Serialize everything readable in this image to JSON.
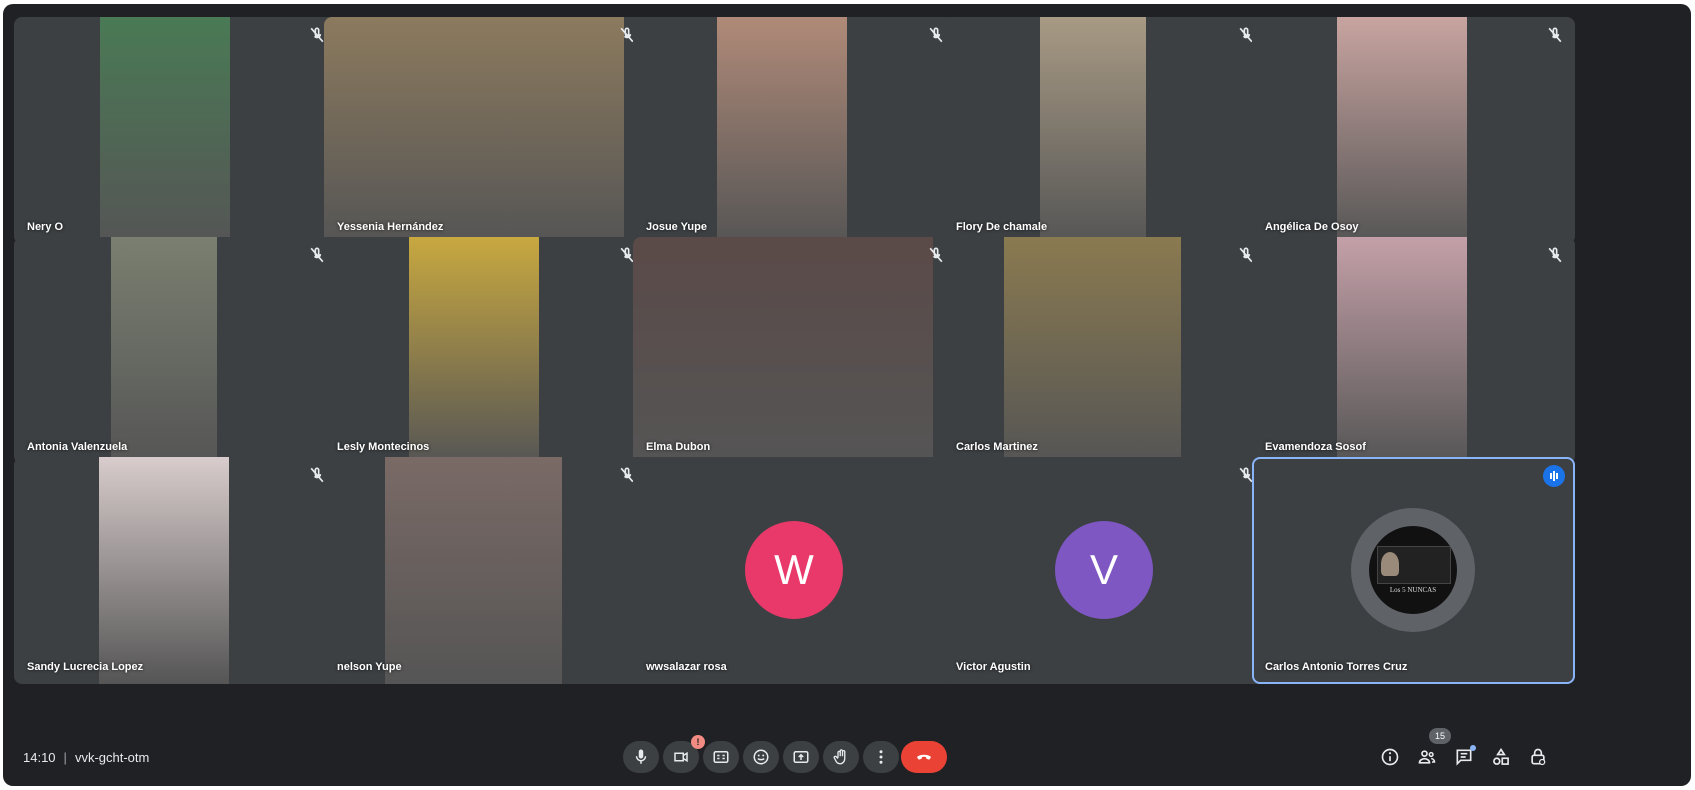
{
  "meeting": {
    "time": "14:10",
    "code": "vvk-gcht-otm",
    "participant_count": "15",
    "camera_warning": "!"
  },
  "participants": [
    {
      "name": "Nery O",
      "muted": true,
      "video_color": "#4a7a55"
    },
    {
      "name": "Yessenia Hernández",
      "muted": true,
      "video_color": "#8c7a5e"
    },
    {
      "name": "Josue Yupe",
      "muted": true,
      "video_color": "#b08a78"
    },
    {
      "name": "Flory De chamale",
      "muted": true,
      "video_color": "#a89a84"
    },
    {
      "name": "Angélica De Osoy",
      "muted": true,
      "video_color": "#c8a4a0"
    },
    {
      "name": "Antonia Valenzuela",
      "muted": true,
      "video_color": "#7a7f70"
    },
    {
      "name": "Lesly Montecinos",
      "muted": true,
      "video_color": "#c8a840"
    },
    {
      "name": "Elma Dubon",
      "muted": true,
      "video_color": "#5a4a48"
    },
    {
      "name": "Carlos Martinez",
      "muted": true,
      "video_color": "#8a7a50"
    },
    {
      "name": "Evamendoza Sosof",
      "muted": true,
      "video_color": "#c4a0a8"
    },
    {
      "name": "Sandy Lucrecia Lopez",
      "muted": true,
      "video_color": "#d8cccc"
    },
    {
      "name": "nelson Yupe",
      "muted": true,
      "video_color": "#7a6a66"
    },
    {
      "name": "wwsalazar rosa",
      "muted": false,
      "avatar_letter": "W",
      "avatar_color": "#e8396a"
    },
    {
      "name": "Victor Agustin",
      "muted": true,
      "avatar_letter": "V",
      "avatar_color": "#7e57c2"
    },
    {
      "name": "Carlos Antonio Torres Cruz",
      "muted": false,
      "speaking": true,
      "avatar_image_caption": "Los 5 NUNCAS"
    }
  ],
  "controls": {
    "accent": "#1a73e8",
    "end_call_color": "#ea4335",
    "icons": [
      "microphone-icon",
      "camera-icon",
      "captions-icon",
      "emoji-icon",
      "present-icon",
      "raise-hand-icon",
      "more-options-icon",
      "end-call-icon"
    ],
    "right_icons": [
      "info-icon",
      "people-icon",
      "chat-icon",
      "activities-icon",
      "host-controls-icon"
    ]
  }
}
